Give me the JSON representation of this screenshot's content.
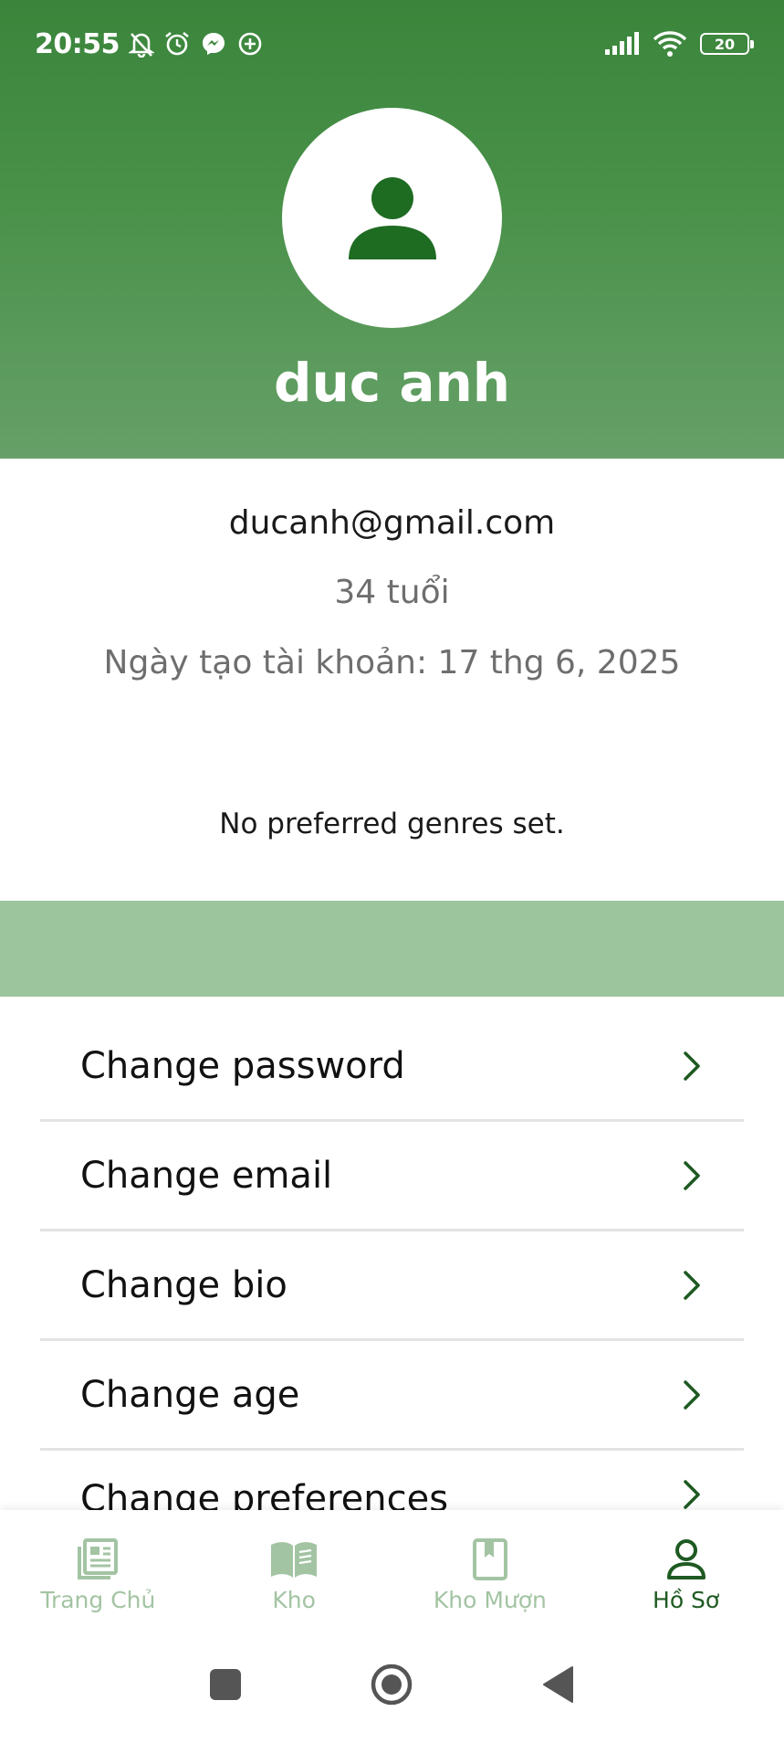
{
  "status_bar": {
    "time": "20:55",
    "battery": "20",
    "left_icons": [
      "bell-off-icon",
      "alarm-icon",
      "messenger-icon",
      "add-circle-icon"
    ],
    "right_icons": [
      "signal-icon",
      "wifi-icon",
      "battery-icon"
    ]
  },
  "profile": {
    "name": "duc anh",
    "email": "ducanh@gmail.com",
    "age": "34 tuổi",
    "created": "Ngày tạo tài khoản: 17 thg 6, 2025",
    "genres": "No preferred genres set."
  },
  "menu": {
    "items": [
      {
        "label": "Change password"
      },
      {
        "label": "Change email"
      },
      {
        "label": "Change bio"
      },
      {
        "label": "Change age"
      },
      {
        "label": "Change preferences"
      }
    ]
  },
  "bottom_nav": {
    "items": [
      {
        "label": "Trang Chủ",
        "icon": "newspaper-icon",
        "active": false
      },
      {
        "label": "Kho",
        "icon": "book-open-icon",
        "active": false
      },
      {
        "label": "Kho Mượn",
        "icon": "bookmark-book-icon",
        "active": false
      },
      {
        "label": "Hồ Sơ",
        "icon": "person-icon",
        "active": true
      }
    ]
  },
  "colors": {
    "primary": "#3a853b",
    "dark_green": "#1e5a22",
    "light_band": "#9dc59d",
    "inactive_nav": "#a3c4a3"
  }
}
